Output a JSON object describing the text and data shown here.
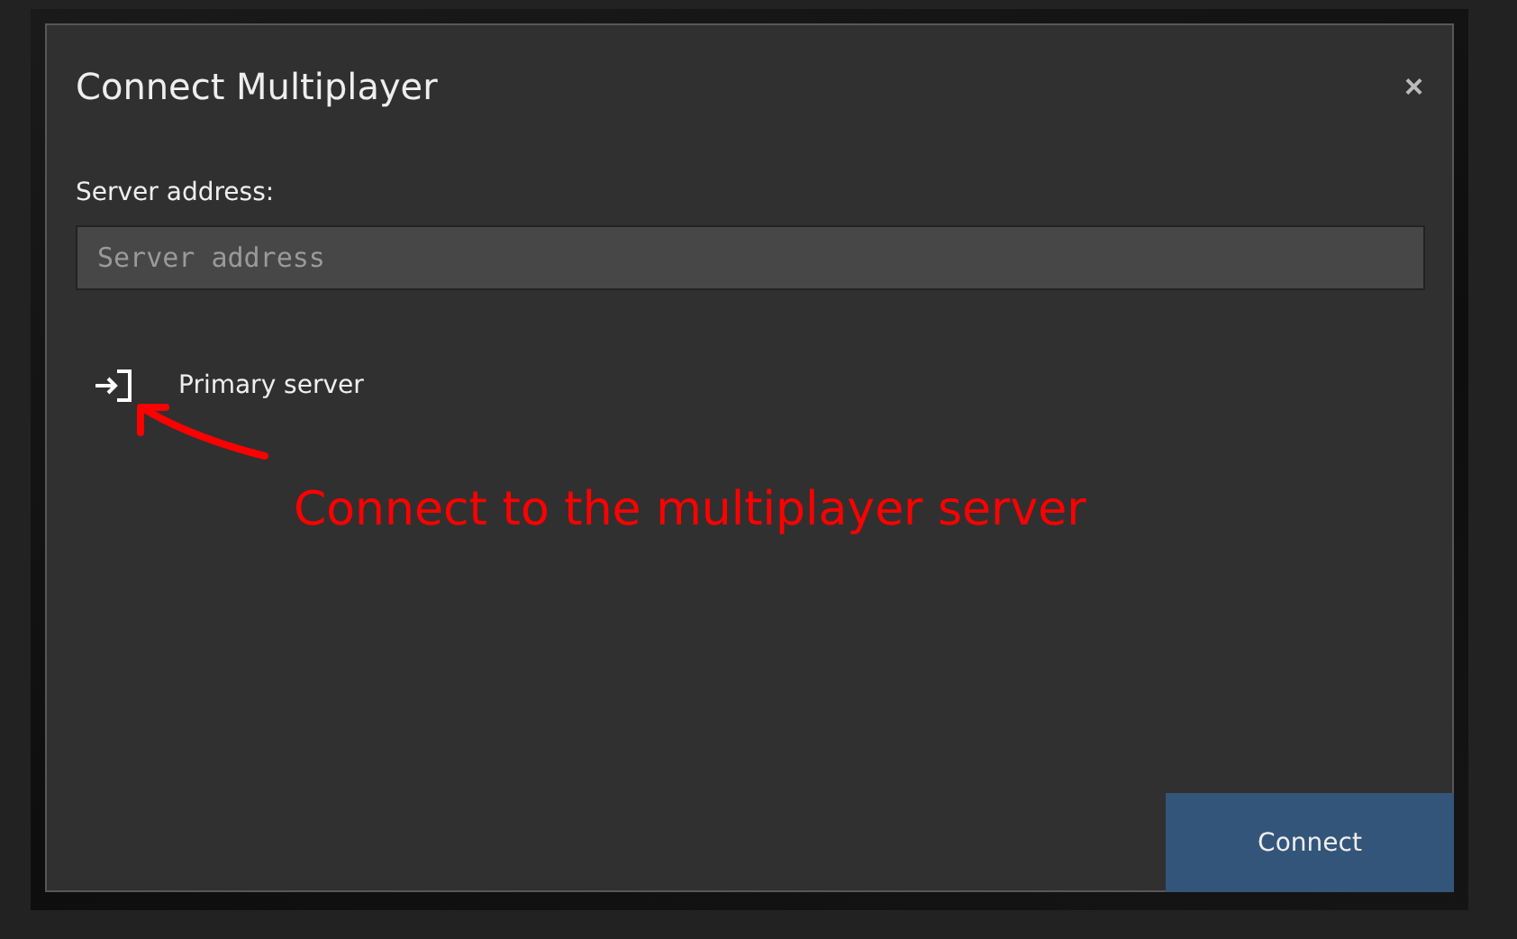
{
  "dialog": {
    "title": "Connect Multiplayer",
    "close": "×",
    "address_label": "Server address:",
    "address_field": {
      "placeholder": "Server address"
    },
    "servers": [
      {
        "name": "Primary server"
      }
    ],
    "connect_button": "Connect"
  },
  "annotation": {
    "text": "Connect to the multiplayer server"
  }
}
